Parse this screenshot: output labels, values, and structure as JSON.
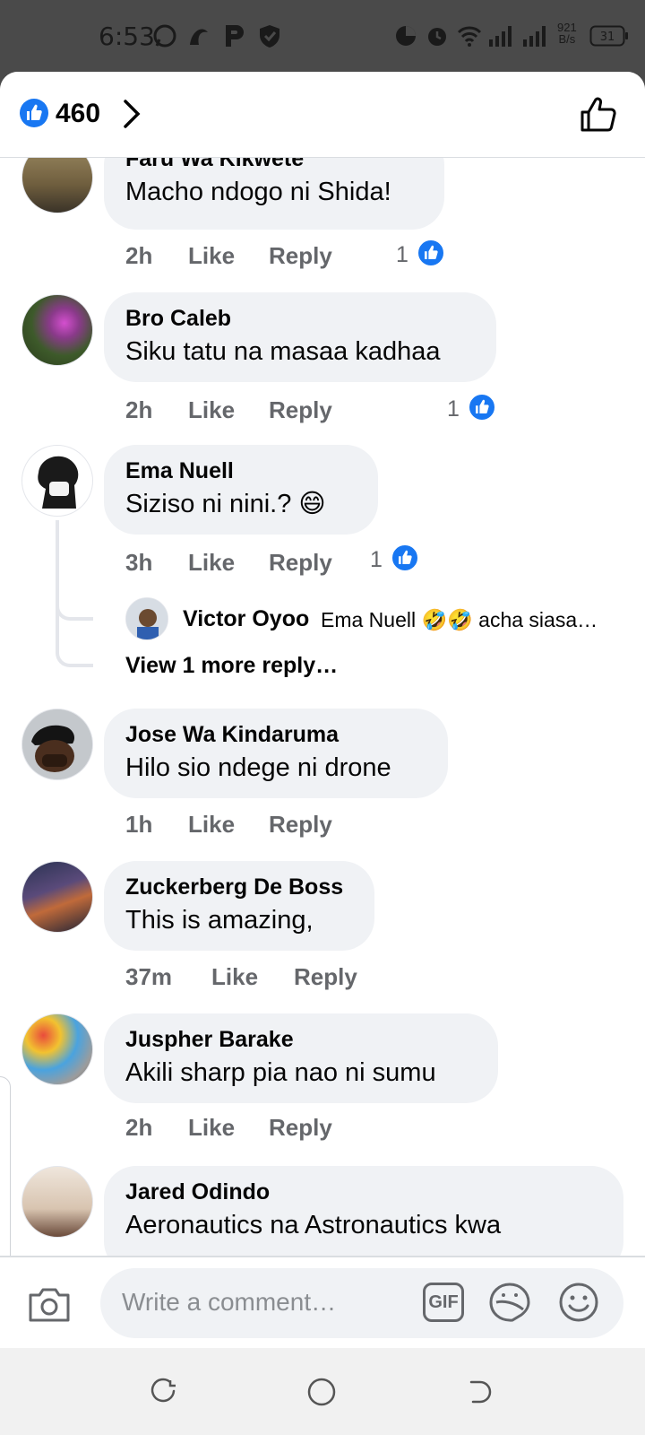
{
  "status_bar": {
    "time": "6:53",
    "net_speed_value": "921",
    "net_speed_unit": "B/s",
    "battery": "31",
    "icons": [
      "whatsapp-icon",
      "pronto-icon",
      "p-app-icon",
      "shield-icon",
      "data-saver-icon",
      "alarm-icon",
      "wifi-icon",
      "signal-icon",
      "signal-icon",
      "battery-icon"
    ]
  },
  "header": {
    "like_count": "460"
  },
  "comments": [
    {
      "name": "Faru Wa Kikwete",
      "text": "Macho ndogo ni Shida!",
      "time": "2h",
      "like": "Like",
      "reply": "Reply",
      "reactions": "1"
    },
    {
      "name": "Bro Caleb",
      "text": "Siku tatu na masaa kadhaa",
      "time": "2h",
      "like": "Like",
      "reply": "Reply",
      "reactions": "1"
    },
    {
      "name": "Ema Nuell",
      "text": "Siziso ni nini.? 😄",
      "time": "3h",
      "like": "Like",
      "reply": "Reply",
      "reactions": "1"
    },
    {
      "name": "Jose Wa Kindaruma",
      "text": "Hilo sio ndege ni drone",
      "time": "1h",
      "like": "Like",
      "reply": "Reply"
    },
    {
      "name": "Zuckerberg De Boss",
      "text": "This is amazing,",
      "time": "37m",
      "like": "Like",
      "reply": "Reply"
    },
    {
      "name": "Juspher Barake",
      "text": "Akili sharp pia nao ni sumu",
      "time": "2h",
      "like": "Like",
      "reply": "Reply"
    },
    {
      "name": "Jared Odindo",
      "text": "Aeronautics na Astronautics  kwa"
    }
  ],
  "reply_preview": {
    "name": "Victor Oyoo",
    "text": "Ema Nuell 🤣🤣 acha siasa…",
    "view_more": "View 1 more reply…"
  },
  "composer": {
    "placeholder": "Write a comment…",
    "gif_label": "GIF"
  },
  "colors": {
    "accent": "#1877f2",
    "bubble": "#f0f2f5",
    "meta_text": "#65676b"
  }
}
